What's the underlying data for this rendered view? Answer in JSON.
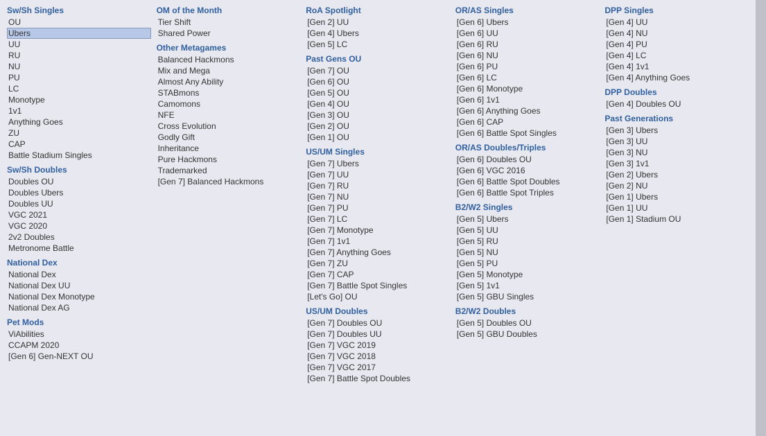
{
  "columns": [
    {
      "id": "col1",
      "sections": [
        {
          "header": "Sw/Sh Singles",
          "items": [
            "OU",
            "Ubers",
            "UU",
            "RU",
            "NU",
            "PU",
            "LC",
            "Monotype",
            "1v1",
            "Anything Goes",
            "ZU",
            "CAP",
            "Battle Stadium Singles"
          ],
          "selected": "Ubers"
        },
        {
          "header": "Sw/Sh Doubles",
          "items": [
            "Doubles OU",
            "Doubles Ubers",
            "Doubles UU",
            "VGC 2021",
            "VGC 2020",
            "2v2 Doubles",
            "Metronome Battle"
          ]
        },
        {
          "header": "National Dex",
          "items": [
            "National Dex",
            "National Dex UU",
            "National Dex Monotype",
            "National Dex AG"
          ]
        },
        {
          "header": "Pet Mods",
          "items": [
            "ViAbilities",
            "CCAPM 2020",
            "[Gen 6] Gen-NEXT OU"
          ]
        }
      ]
    },
    {
      "id": "col2",
      "sections": [
        {
          "header": "OM of the Month",
          "items": [
            "Tier Shift",
            "Shared Power"
          ]
        },
        {
          "header": "Other Metagames",
          "items": [
            "Balanced Hackmons",
            "Mix and Mega",
            "Almost Any Ability",
            "STABmons",
            "Camomons",
            "NFE",
            "Cross Evolution",
            "Godly Gift",
            "Inheritance",
            "Pure Hackmons",
            "Trademarked",
            "[Gen 7] Balanced Hackmons"
          ]
        }
      ]
    },
    {
      "id": "col3",
      "sections": [
        {
          "header": "RoA Spotlight",
          "items": [
            "[Gen 2] UU",
            "[Gen 4] Ubers",
            "[Gen 5] LC"
          ]
        },
        {
          "header": "Past Gens OU",
          "items": [
            "[Gen 7] OU",
            "[Gen 6] OU",
            "[Gen 5] OU",
            "[Gen 4] OU",
            "[Gen 3] OU",
            "[Gen 2] OU",
            "[Gen 1] OU"
          ]
        },
        {
          "header": "US/UM Singles",
          "items": [
            "[Gen 7] Ubers",
            "[Gen 7] UU",
            "[Gen 7] RU",
            "[Gen 7] NU",
            "[Gen 7] PU",
            "[Gen 7] LC",
            "[Gen 7] Monotype",
            "[Gen 7] 1v1",
            "[Gen 7] Anything Goes",
            "[Gen 7] ZU",
            "[Gen 7] CAP",
            "[Gen 7] Battle Spot Singles",
            "[Let's Go] OU"
          ]
        },
        {
          "header": "US/UM Doubles",
          "items": [
            "[Gen 7] Doubles OU",
            "[Gen 7] Doubles UU",
            "[Gen 7] VGC 2019",
            "[Gen 7] VGC 2018",
            "[Gen 7] VGC 2017",
            "[Gen 7] Battle Spot Doubles"
          ]
        }
      ]
    },
    {
      "id": "col4",
      "sections": [
        {
          "header": "OR/AS Singles",
          "items": [
            "[Gen 6] Ubers",
            "[Gen 6] UU",
            "[Gen 6] RU",
            "[Gen 6] NU",
            "[Gen 6] PU",
            "[Gen 6] LC",
            "[Gen 6] Monotype",
            "[Gen 6] 1v1",
            "[Gen 6] Anything Goes",
            "[Gen 6] CAP",
            "[Gen 6] Battle Spot Singles"
          ]
        },
        {
          "header": "OR/AS Doubles/Triples",
          "items": [
            "[Gen 6] Doubles OU",
            "[Gen 6] VGC 2016",
            "[Gen 6] Battle Spot Doubles",
            "[Gen 6] Battle Spot Triples"
          ]
        },
        {
          "header": "B2/W2 Singles",
          "items": [
            "[Gen 5] Ubers",
            "[Gen 5] UU",
            "[Gen 5] RU",
            "[Gen 5] NU",
            "[Gen 5] PU",
            "[Gen 5] Monotype",
            "[Gen 5] 1v1",
            "[Gen 5] GBU Singles"
          ]
        },
        {
          "header": "B2/W2 Doubles",
          "items": [
            "[Gen 5] Doubles OU",
            "[Gen 5] GBU Doubles"
          ]
        }
      ]
    },
    {
      "id": "col5",
      "sections": [
        {
          "header": "DPP Singles",
          "items": [
            "[Gen 4] UU",
            "[Gen 4] NU",
            "[Gen 4] PU",
            "[Gen 4] LC",
            "[Gen 4] 1v1",
            "[Gen 4] Anything Goes"
          ]
        },
        {
          "header": "DPP Doubles",
          "items": [
            "[Gen 4] Doubles OU"
          ]
        },
        {
          "header": "Past Generations",
          "items": [
            "[Gen 3] Ubers",
            "[Gen 3] UU",
            "[Gen 3] NU",
            "[Gen 3] 1v1",
            "[Gen 2] Ubers",
            "[Gen 2] NU",
            "[Gen 1] Ubers",
            "[Gen 1] UU",
            "[Gen 1] Stadium OU"
          ]
        }
      ]
    }
  ]
}
